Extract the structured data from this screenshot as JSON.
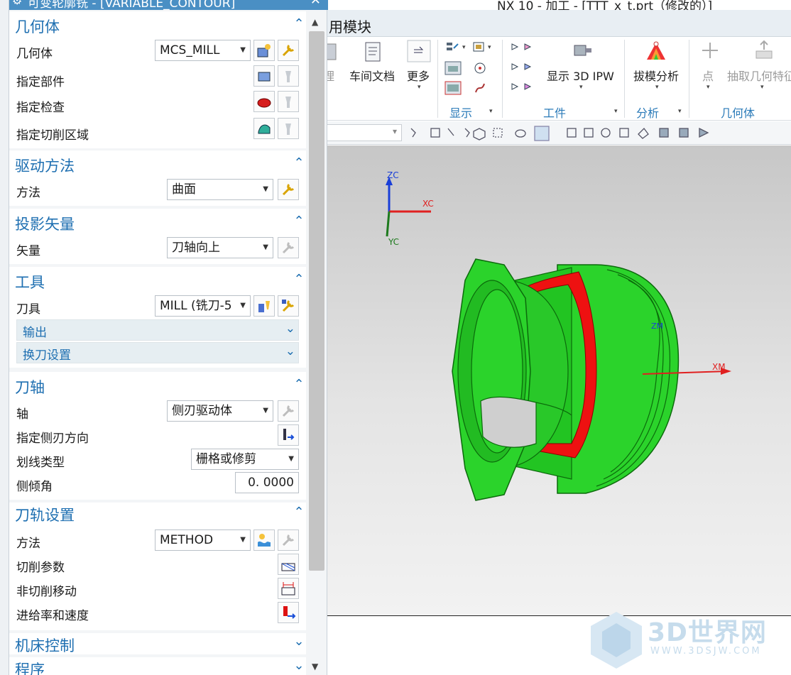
{
  "window": {
    "app_title": "NX 10 - 加工 - [TTT_x_t.prt（修改的）]"
  },
  "dialog": {
    "title": "可变轮廓铣 - [VARIABLE_CONTOUR]"
  },
  "ribbon": {
    "tab_label": "用模块",
    "labels": {
      "manage": "理",
      "shop_docs": "车间文档",
      "more": "更多",
      "ipw": "显示 3D IPW",
      "draft": "拔模分析",
      "point": "点",
      "extract": "抽取几何特征"
    },
    "groups": {
      "display": "显示",
      "workpiece": "工件",
      "analysis": "分析",
      "geometry": "几何体"
    }
  },
  "viewport": {
    "axes": {
      "zc": "ZC",
      "xc": "XC",
      "yc": "YC",
      "xm": "XM",
      "zm": "ZM"
    }
  },
  "watermark": {
    "text": "3D世界网",
    "url": "WWW.3DSJW.COM"
  },
  "sections": {
    "geometry": {
      "title": "几何体",
      "geom_label": "几何体",
      "geom_value": "MCS_MILL",
      "part_label": "指定部件",
      "check_label": "指定检查",
      "cut_area_label": "指定切削区域"
    },
    "drive": {
      "title": "驱动方法",
      "method_label": "方法",
      "method_value": "曲面"
    },
    "projection": {
      "title": "投影矢量",
      "vector_label": "矢量",
      "vector_value": "刀轴向上"
    },
    "tool": {
      "title": "工具",
      "tool_label": "刀具",
      "tool_value": "MILL (铣刀-5",
      "output_label": "输出",
      "tool_change_label": "换刀设置"
    },
    "tool_axis": {
      "title": "刀轴",
      "axis_label": "轴",
      "axis_value": "侧刃驱动体",
      "side_dir_label": "指定侧刃方向",
      "pattern_label": "划线类型",
      "pattern_value": "栅格或修剪",
      "tilt_label": "侧倾角",
      "tilt_value": "0. 0000"
    },
    "path": {
      "title": "刀轨设置",
      "method_label": "方法",
      "method_value": "METHOD",
      "cut_params_label": "切削参数",
      "noncut_label": "非切削移动",
      "feeds_label": "进给率和速度"
    },
    "machine": {
      "title": "机床控制"
    },
    "program": {
      "title": "程序"
    }
  },
  "colors": {
    "accent": "#1e6fb1",
    "part_green": "#2edc2e",
    "face_red": "#ee1111"
  }
}
